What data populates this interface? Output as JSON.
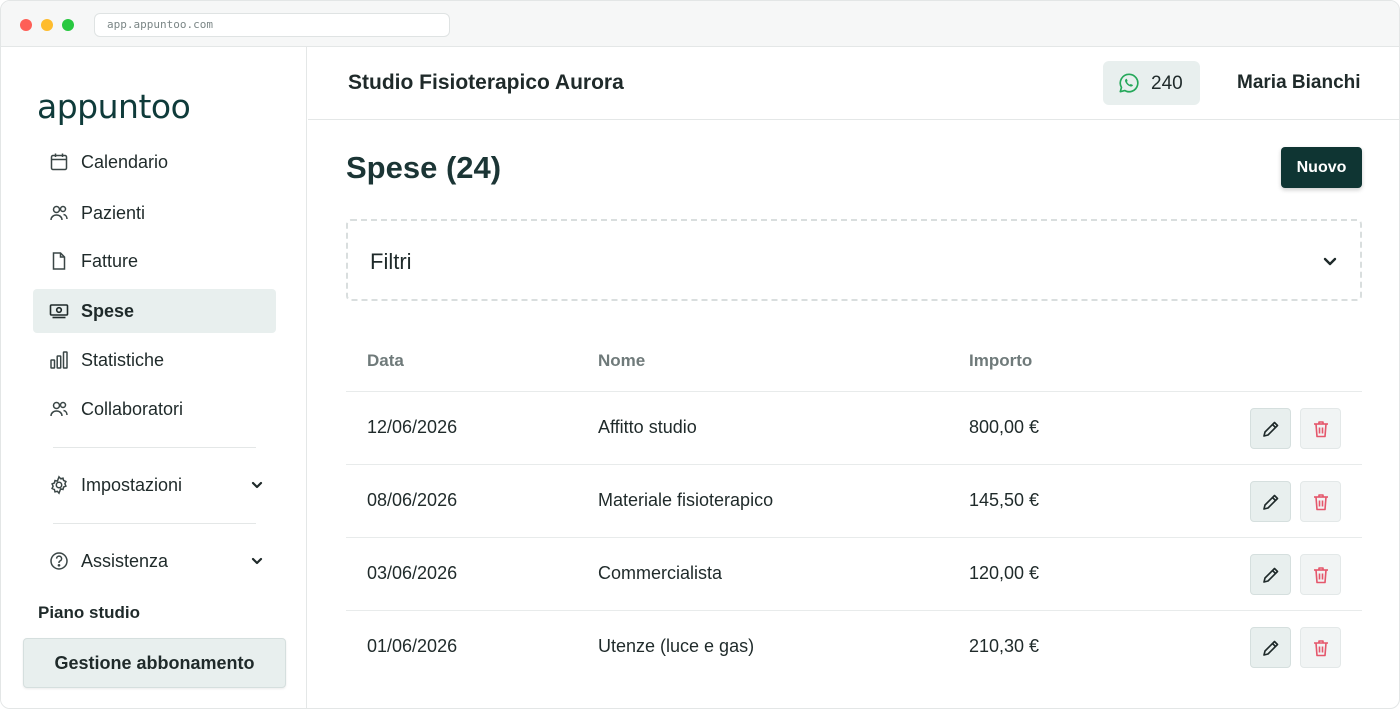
{
  "browser": {
    "url": "app.appuntoo.com"
  },
  "sidebar": {
    "logo": "appuntoo",
    "items": [
      {
        "label": "Calendario",
        "icon": "calendar-icon"
      },
      {
        "label": "Pazienti",
        "icon": "users-icon"
      },
      {
        "label": "Fatture",
        "icon": "document-icon"
      },
      {
        "label": "Spese",
        "icon": "money-icon",
        "active": true
      },
      {
        "label": "Statistiche",
        "icon": "bar-chart-icon"
      },
      {
        "label": "Collaboratori",
        "icon": "users-icon"
      },
      {
        "label": "Impostazioni",
        "icon": "gear-icon"
      },
      {
        "label": "Assistenza",
        "icon": "help-circle-icon"
      }
    ],
    "plan": {
      "title": "Piano studio",
      "button_label": "Gestione abbonamento"
    }
  },
  "header": {
    "studio_name": "Studio Fisioterapico Aurora",
    "whatsapp_credits": "240",
    "user_name": "Maria Bianchi"
  },
  "main": {
    "title": "Spese (24)",
    "new_button_label": "Nuovo",
    "filters_label": "Filtri",
    "table": {
      "headers": [
        "Data",
        "Nome",
        "Importo"
      ],
      "rows": [
        {
          "date": "12/06/2026",
          "name": "Affitto studio",
          "amount": "800,00 €"
        },
        {
          "date": "08/06/2026",
          "name": "Materiale fisioterapico",
          "amount": "145,50 €"
        },
        {
          "date": "03/06/2026",
          "name": "Commercialista",
          "amount": "120,00 €"
        },
        {
          "date": "01/06/2026",
          "name": "Utenze (luce e gas)",
          "amount": "210,30 €"
        }
      ]
    }
  },
  "colors": {
    "brand_dark": "#0f3533",
    "active_bg": "#e8efee",
    "whatsapp_green": "#25a85a",
    "delete_red": "#e5566b"
  }
}
